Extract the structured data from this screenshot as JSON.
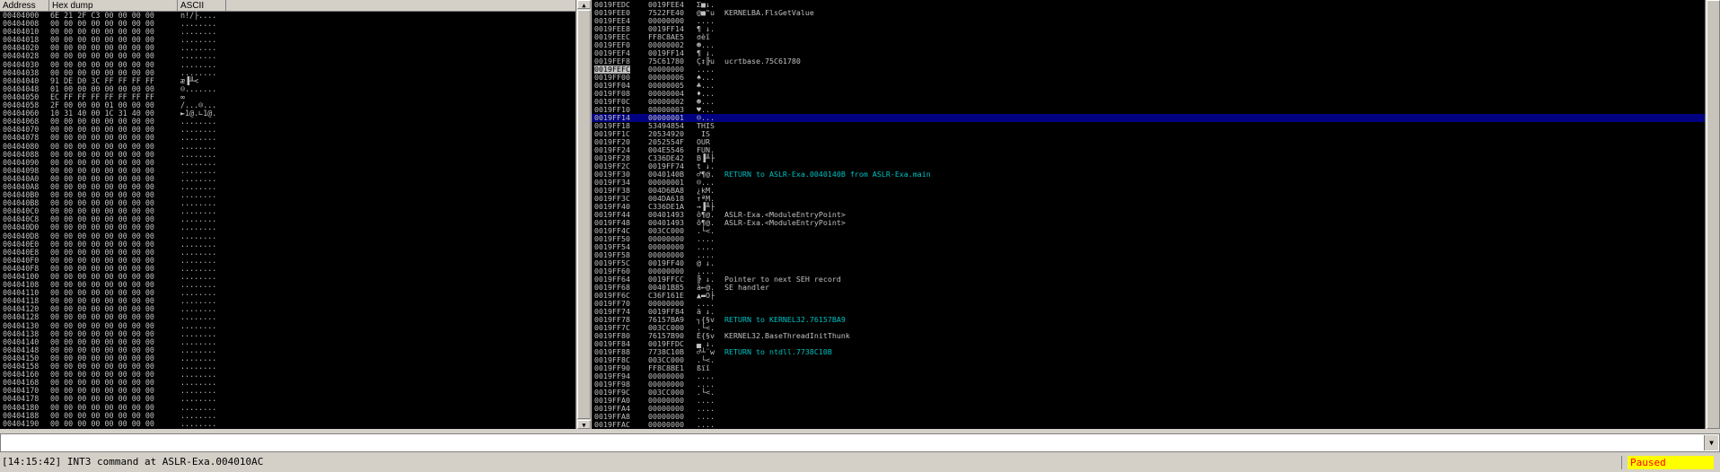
{
  "dump": {
    "headers": {
      "address": "Address",
      "hex": "Hex dump",
      "ascii": "ASCII"
    },
    "rows": [
      {
        "addr": "00404000",
        "hex": "6E 21 2F C3 00 00 00 00",
        "ascii": "n!/├...."
      },
      {
        "addr": "00404008",
        "hex": "00 00 00 00 00 00 00 00",
        "ascii": "........"
      },
      {
        "addr": "00404010",
        "hex": "00 00 00 00 00 00 00 00",
        "ascii": "........"
      },
      {
        "addr": "00404018",
        "hex": "00 00 00 00 00 00 00 00",
        "ascii": "........"
      },
      {
        "addr": "00404020",
        "hex": "00 00 00 00 00 00 00 00",
        "ascii": "........"
      },
      {
        "addr": "00404028",
        "hex": "00 00 00 00 00 00 00 00",
        "ascii": "........"
      },
      {
        "addr": "00404030",
        "hex": "00 00 00 00 00 00 00 00",
        "ascii": "........"
      },
      {
        "addr": "00404038",
        "hex": "00 00 00 00 00 00 00 00",
        "ascii": "........"
      },
      {
        "addr": "00404040",
        "hex": "91 DE D0 3C FF FF FF FF",
        "ascii": "æ▐╨<"
      },
      {
        "addr": "00404048",
        "hex": "01 00 00 00 00 00 00 00",
        "ascii": "☺......."
      },
      {
        "addr": "00404050",
        "hex": "EC FF FF FF FF FF FF FF",
        "ascii": "∞"
      },
      {
        "addr": "00404058",
        "hex": "2F 00 00 00 01 00 00 00",
        "ascii": "/...☺..."
      },
      {
        "addr": "00404060",
        "hex": "10 31 40 00 1C 31 40 00",
        "ascii": "►1@.∟1@."
      },
      {
        "addr": "00404068",
        "hex": "00 00 00 00 00 00 00 00",
        "ascii": "........"
      },
      {
        "addr": "00404070",
        "hex": "00 00 00 00 00 00 00 00",
        "ascii": "........"
      },
      {
        "addr": "00404078",
        "hex": "00 00 00 00 00 00 00 00",
        "ascii": "........"
      },
      {
        "addr": "00404080",
        "hex": "00 00 00 00 00 00 00 00",
        "ascii": "........"
      },
      {
        "addr": "00404088",
        "hex": "00 00 00 00 00 00 00 00",
        "ascii": "........"
      },
      {
        "addr": "00404090",
        "hex": "00 00 00 00 00 00 00 00",
        "ascii": "........"
      },
      {
        "addr": "00404098",
        "hex": "00 00 00 00 00 00 00 00",
        "ascii": "........"
      },
      {
        "addr": "004040A0",
        "hex": "00 00 00 00 00 00 00 00",
        "ascii": "........"
      },
      {
        "addr": "004040A8",
        "hex": "00 00 00 00 00 00 00 00",
        "ascii": "........"
      },
      {
        "addr": "004040B0",
        "hex": "00 00 00 00 00 00 00 00",
        "ascii": "........"
      },
      {
        "addr": "004040B8",
        "hex": "00 00 00 00 00 00 00 00",
        "ascii": "........"
      },
      {
        "addr": "004040C0",
        "hex": "00 00 00 00 00 00 00 00",
        "ascii": "........"
      },
      {
        "addr": "004040C8",
        "hex": "00 00 00 00 00 00 00 00",
        "ascii": "........"
      },
      {
        "addr": "004040D0",
        "hex": "00 00 00 00 00 00 00 00",
        "ascii": "........"
      },
      {
        "addr": "004040D8",
        "hex": "00 00 00 00 00 00 00 00",
        "ascii": "........"
      },
      {
        "addr": "004040E0",
        "hex": "00 00 00 00 00 00 00 00",
        "ascii": "........"
      },
      {
        "addr": "004040E8",
        "hex": "00 00 00 00 00 00 00 00",
        "ascii": "........"
      },
      {
        "addr": "004040F0",
        "hex": "00 00 00 00 00 00 00 00",
        "ascii": "........"
      },
      {
        "addr": "004040F8",
        "hex": "00 00 00 00 00 00 00 00",
        "ascii": "........"
      },
      {
        "addr": "00404100",
        "hex": "00 00 00 00 00 00 00 00",
        "ascii": "........"
      },
      {
        "addr": "00404108",
        "hex": "00 00 00 00 00 00 00 00",
        "ascii": "........"
      },
      {
        "addr": "00404110",
        "hex": "00 00 00 00 00 00 00 00",
        "ascii": "........"
      },
      {
        "addr": "00404118",
        "hex": "00 00 00 00 00 00 00 00",
        "ascii": "........"
      },
      {
        "addr": "00404120",
        "hex": "00 00 00 00 00 00 00 00",
        "ascii": "........"
      },
      {
        "addr": "00404128",
        "hex": "00 00 00 00 00 00 00 00",
        "ascii": "........"
      },
      {
        "addr": "00404130",
        "hex": "00 00 00 00 00 00 00 00",
        "ascii": "........"
      },
      {
        "addr": "00404138",
        "hex": "00 00 00 00 00 00 00 00",
        "ascii": "........"
      },
      {
        "addr": "00404140",
        "hex": "00 00 00 00 00 00 00 00",
        "ascii": "........"
      },
      {
        "addr": "00404148",
        "hex": "00 00 00 00 00 00 00 00",
        "ascii": "........"
      },
      {
        "addr": "00404150",
        "hex": "00 00 00 00 00 00 00 00",
        "ascii": "........"
      },
      {
        "addr": "00404158",
        "hex": "00 00 00 00 00 00 00 00",
        "ascii": "........"
      },
      {
        "addr": "00404160",
        "hex": "00 00 00 00 00 00 00 00",
        "ascii": "........"
      },
      {
        "addr": "00404168",
        "hex": "00 00 00 00 00 00 00 00",
        "ascii": "........"
      },
      {
        "addr": "00404170",
        "hex": "00 00 00 00 00 00 00 00",
        "ascii": "........"
      },
      {
        "addr": "00404178",
        "hex": "00 00 00 00 00 00 00 00",
        "ascii": "........"
      },
      {
        "addr": "00404180",
        "hex": "00 00 00 00 00 00 00 00",
        "ascii": "........"
      },
      {
        "addr": "00404188",
        "hex": "00 00 00 00 00 00 00 00",
        "ascii": "........"
      },
      {
        "addr": "00404190",
        "hex": "00 00 00 00 00 00 00 00",
        "ascii": "........"
      }
    ]
  },
  "stack": {
    "rows": [
      {
        "addr": "0019FEDC",
        "val": "0019FEE4",
        "ascii": "Σ■↓.",
        "cmt": ""
      },
      {
        "addr": "0019FEE0",
        "val": "7522FE40",
        "ascii": "@■\"u",
        "cmt": "KERNELBA.FlsGetValue"
      },
      {
        "addr": "0019FEE4",
        "val": "00000000",
        "ascii": "....",
        "cmt": ""
      },
      {
        "addr": "0019FEE8",
        "val": "0019FF14",
        "ascii": "¶ ↓.",
        "cmt": ""
      },
      {
        "addr": "0019FEEC",
        "val": "FF8C8AE5",
        "ascii": "σèî",
        "cmt": ""
      },
      {
        "addr": "0019FEF0",
        "val": "00000002",
        "ascii": "☻...",
        "cmt": ""
      },
      {
        "addr": "0019FEF4",
        "val": "0019FF14",
        "ascii": "¶ ↓.",
        "cmt": ""
      },
      {
        "addr": "0019FEF8",
        "val": "75C61780",
        "ascii": "Ç↕╠u",
        "cmt": "ucrtbase.75C61780"
      },
      {
        "addr": "0019FEFC",
        "val": "00000000",
        "ascii": "....",
        "cmt": ""
      },
      {
        "addr": "0019FF00",
        "val": "00000006",
        "ascii": "♠...",
        "cmt": ""
      },
      {
        "addr": "0019FF04",
        "val": "00000005",
        "ascii": "♣...",
        "cmt": ""
      },
      {
        "addr": "0019FF08",
        "val": "00000004",
        "ascii": "♦...",
        "cmt": ""
      },
      {
        "addr": "0019FF0C",
        "val": "00000002",
        "ascii": "☻...",
        "cmt": ""
      },
      {
        "addr": "0019FF10",
        "val": "00000003",
        "ascii": "♥...",
        "cmt": ""
      },
      {
        "addr": "0019FF14",
        "val": "00000001",
        "ascii": "☺...",
        "cmt": ""
      },
      {
        "addr": "0019FF18",
        "val": "53494854",
        "ascii": "THIS",
        "cmt": ""
      },
      {
        "addr": "0019FF1C",
        "val": "20534920",
        "ascii": " IS ",
        "cmt": ""
      },
      {
        "addr": "0019FF20",
        "val": "2052554F",
        "ascii": "OUR ",
        "cmt": ""
      },
      {
        "addr": "0019FF24",
        "val": "004E5546",
        "ascii": "FUN.",
        "cmt": ""
      },
      {
        "addr": "0019FF28",
        "val": "C336DE42",
        "ascii": "B▐╨├",
        "cmt": ""
      },
      {
        "addr": "0019FF2C",
        "val": "0019FF74",
        "ascii": "t ↓.",
        "cmt": ""
      },
      {
        "addr": "0019FF30",
        "val": "0040140B",
        "ascii": "♂¶@.",
        "cmt": "RETURN to ASLR-Exa.0040140B from ASLR-Exa.main"
      },
      {
        "addr": "0019FF34",
        "val": "00000001",
        "ascii": "☺...",
        "cmt": ""
      },
      {
        "addr": "0019FF38",
        "val": "004D6BA8",
        "ascii": "¿kM.",
        "cmt": ""
      },
      {
        "addr": "0019FF3C",
        "val": "004DA618",
        "ascii": "↑ªM.",
        "cmt": ""
      },
      {
        "addr": "0019FF40",
        "val": "C336DE1A",
        "ascii": "→▐╨├",
        "cmt": ""
      },
      {
        "addr": "0019FF44",
        "val": "00401493",
        "ascii": "ô¶@.",
        "cmt": "ASLR-Exa.<ModuleEntryPoint>"
      },
      {
        "addr": "0019FF48",
        "val": "00401493",
        "ascii": "ô¶@.",
        "cmt": "ASLR-Exa.<ModuleEntryPoint>"
      },
      {
        "addr": "0019FF4C",
        "val": "003CC000",
        "ascii": ".└<.",
        "cmt": ""
      },
      {
        "addr": "0019FF50",
        "val": "00000000",
        "ascii": "....",
        "cmt": ""
      },
      {
        "addr": "0019FF54",
        "val": "00000000",
        "ascii": "....",
        "cmt": ""
      },
      {
        "addr": "0019FF58",
        "val": "00000000",
        "ascii": "....",
        "cmt": ""
      },
      {
        "addr": "0019FF5C",
        "val": "0019FF40",
        "ascii": "@ ↓.",
        "cmt": ""
      },
      {
        "addr": "0019FF60",
        "val": "00000000",
        "ascii": "....",
        "cmt": ""
      },
      {
        "addr": "0019FF64",
        "val": "0019FFCC",
        "ascii": "╠ ↓.",
        "cmt": "Pointer to next SEH record"
      },
      {
        "addr": "0019FF68",
        "val": "00401B85",
        "ascii": "à←@.",
        "cmt": "SE handler"
      },
      {
        "addr": "0019FF6C",
        "val": "C36F161E",
        "ascii": "▲▬O├",
        "cmt": ""
      },
      {
        "addr": "0019FF70",
        "val": "00000000",
        "ascii": "....",
        "cmt": ""
      },
      {
        "addr": "0019FF74",
        "val": "0019FF84",
        "ascii": "ä ↓.",
        "cmt": ""
      },
      {
        "addr": "0019FF78",
        "val": "76157BA9",
        "ascii": "┐{§v",
        "cmt": "RETURN to KERNEL32.76157BA9"
      },
      {
        "addr": "0019FF7C",
        "val": "003CC000",
        "ascii": ".└<.",
        "cmt": ""
      },
      {
        "addr": "0019FF80",
        "val": "76157B90",
        "ascii": "É{§v",
        "cmt": "KERNEL32.BaseThreadInitThunk"
      },
      {
        "addr": "0019FF84",
        "val": "0019FFDC",
        "ascii": "▄ ↓.",
        "cmt": ""
      },
      {
        "addr": "0019FF88",
        "val": "7738C10B",
        "ascii": "♂┴¨w",
        "cmt": "RETURN to ntdll.7738C10B"
      },
      {
        "addr": "0019FF8C",
        "val": "003CC000",
        "ascii": ".└<.",
        "cmt": ""
      },
      {
        "addr": "0019FF90",
        "val": "FF8C8BE1",
        "ascii": "ßïî",
        "cmt": ""
      },
      {
        "addr": "0019FF94",
        "val": "00000000",
        "ascii": "....",
        "cmt": ""
      },
      {
        "addr": "0019FF98",
        "val": "00000000",
        "ascii": "....",
        "cmt": ""
      },
      {
        "addr": "0019FF9C",
        "val": "003CC000",
        "ascii": ".└<.",
        "cmt": ""
      },
      {
        "addr": "0019FFA0",
        "val": "00000000",
        "ascii": "....",
        "cmt": ""
      },
      {
        "addr": "0019FFA4",
        "val": "00000000",
        "ascii": "....",
        "cmt": ""
      },
      {
        "addr": "0019FFA8",
        "val": "00000000",
        "ascii": "....",
        "cmt": ""
      },
      {
        "addr": "0019FFAC",
        "val": "00000000",
        "ascii": "....",
        "cmt": ""
      }
    ],
    "selected_index": 14,
    "highlighted_addr_index": 8
  },
  "status": {
    "message": "[14:15:42] INT3 command at ASLR-Exa.004010AC",
    "state": "Paused"
  },
  "colors": {
    "pane_bg": "#000000",
    "text": "#c0c0c0",
    "selection": "#000080",
    "comment_accent": "#00c0c0",
    "paused_bg": "#ffff00",
    "paused_fg": "#ff0000"
  }
}
